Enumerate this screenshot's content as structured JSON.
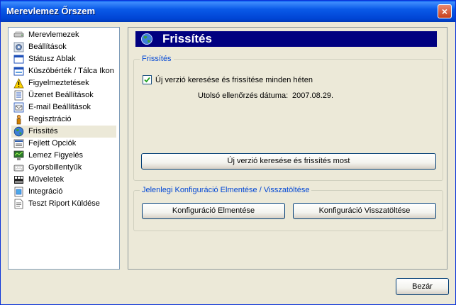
{
  "window": {
    "title": "Merevlemez Őrszem",
    "close_label": "×"
  },
  "sidebar": {
    "items": [
      {
        "label": "Merevlemezek",
        "icon": "hard-drive-icon",
        "selected": false
      },
      {
        "label": "Beállítások",
        "icon": "settings-icon",
        "selected": false
      },
      {
        "label": "Státusz Ablak",
        "icon": "window-icon",
        "selected": false
      },
      {
        "label": "Küszöbérték / Tálca Ikon",
        "icon": "threshold-icon",
        "selected": false
      },
      {
        "label": "Figyelmeztetések",
        "icon": "warning-icon",
        "selected": false
      },
      {
        "label": "Üzenet Beállítások",
        "icon": "message-icon",
        "selected": false
      },
      {
        "label": "E-mail Beállítások",
        "icon": "email-icon",
        "selected": false
      },
      {
        "label": "Regisztráció",
        "icon": "registration-icon",
        "selected": false
      },
      {
        "label": "Frissítés",
        "icon": "globe-icon",
        "selected": true
      },
      {
        "label": "Fejlett Opciók",
        "icon": "advanced-options-icon",
        "selected": false
      },
      {
        "label": "Lemez Figyelés",
        "icon": "disk-monitor-icon",
        "selected": false
      },
      {
        "label": "Gyorsbillentyűk",
        "icon": "keyboard-icon",
        "selected": false
      },
      {
        "label": "Műveletek",
        "icon": "actions-icon",
        "selected": false
      },
      {
        "label": "Integráció",
        "icon": "integration-icon",
        "selected": false
      },
      {
        "label": "Teszt Riport Küldése",
        "icon": "report-icon",
        "selected": false
      }
    ]
  },
  "panel": {
    "header_title": "Frissítés",
    "update_group": {
      "legend": "Frissítés",
      "checkbox_label": "Új verzió keresése és frissítése minden héten",
      "checkbox_checked": true,
      "last_check_label": "Utolsó ellenőrzés dátuma:",
      "last_check_value": "2007.08.29.",
      "check_now_button": "Új verzió keresése és frissítés most"
    },
    "config_group": {
      "legend": "Jelenlegi Konfiguráció Elmentése / Visszatöltése",
      "save_button": "Konfiguráció Elmentése",
      "restore_button": "Konfiguráció Visszatöltése"
    }
  },
  "footer": {
    "close_button": "Bezár"
  }
}
